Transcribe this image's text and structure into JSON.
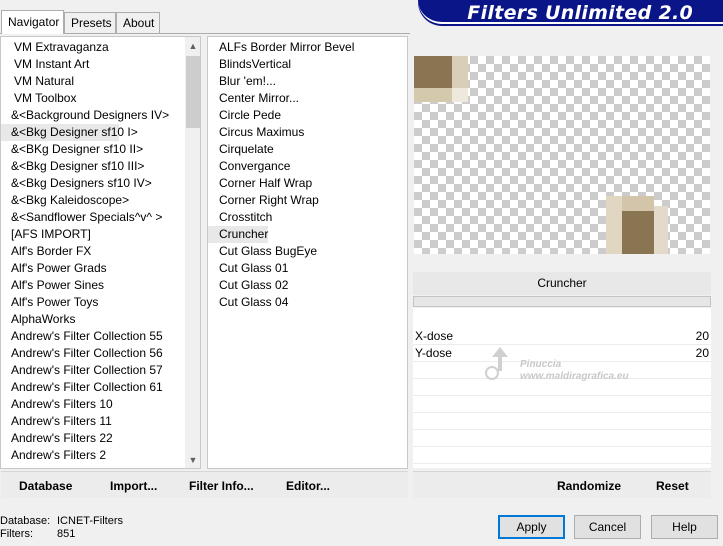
{
  "tabs": [
    {
      "label": "Navigator",
      "active": true
    },
    {
      "label": "Presets",
      "active": false
    },
    {
      "label": "About",
      "active": false
    }
  ],
  "banner": {
    "title": "Filters Unlimited 2.0",
    "color": "#0a1688"
  },
  "categories": {
    "items": [
      "VM Extravaganza",
      "VM Instant Art",
      "VM Natural",
      "VM Toolbox",
      "&<Background Designers IV>",
      "&<Bkg Designer sf10 I>",
      "&<BKg Designer sf10 II>",
      "&<Bkg Designer sf10 III>",
      "&<Bkg Designers sf10 IV>",
      "&<Bkg Kaleidoscope>",
      "&<Sandflower Specials^v^ >",
      "[AFS IMPORT]",
      "Alf's Border FX",
      "Alf's Power Grads",
      "Alf's Power Sines",
      "Alf's Power Toys",
      "AlphaWorks",
      "Andrew's Filter Collection 55",
      "Andrew's Filter Collection 56",
      "Andrew's Filter Collection 57",
      "Andrew's Filter Collection 61",
      "Andrew's Filters 10",
      "Andrew's Filters 11",
      "Andrew's Filters 22",
      "Andrew's Filters 2"
    ],
    "selected_index": 5,
    "scroll_up_icon": "chevron-up-icon",
    "scroll_down_icon": "chevron-down-icon"
  },
  "filters": {
    "items": [
      "ALFs Border Mirror Bevel",
      "BlindsVertical",
      "Blur 'em!...",
      "Center Mirror...",
      "Circle Pede",
      "Circus Maximus",
      "Cirquelate",
      "Convergance",
      "Corner Half Wrap",
      "Corner Right Wrap",
      "Crosstitch",
      "Cruncher",
      "Cut Glass  BugEye",
      "Cut Glass 01",
      "Cut Glass 02",
      "Cut Glass 04"
    ],
    "selected_index": 11
  },
  "preview": {
    "filter_name": "Cruncher",
    "blob_color": "#8a7552"
  },
  "params": [
    {
      "label": "X-dose",
      "value": "20"
    },
    {
      "label": "Y-dose",
      "value": "20"
    }
  ],
  "watermark": {
    "line1": "Pinuccia",
    "line2": "www.maldiragrafica.eu"
  },
  "left_actions": [
    "Database",
    "Import...",
    "Filter Info...",
    "Editor..."
  ],
  "right_actions": [
    "Randomize",
    "Reset"
  ],
  "status": {
    "database_label": "Database:",
    "database_value": "ICNET-Filters",
    "filters_label": "Filters:",
    "filters_value": "851"
  },
  "dialog_buttons": {
    "apply": "Apply",
    "cancel": "Cancel",
    "help": "Help"
  }
}
